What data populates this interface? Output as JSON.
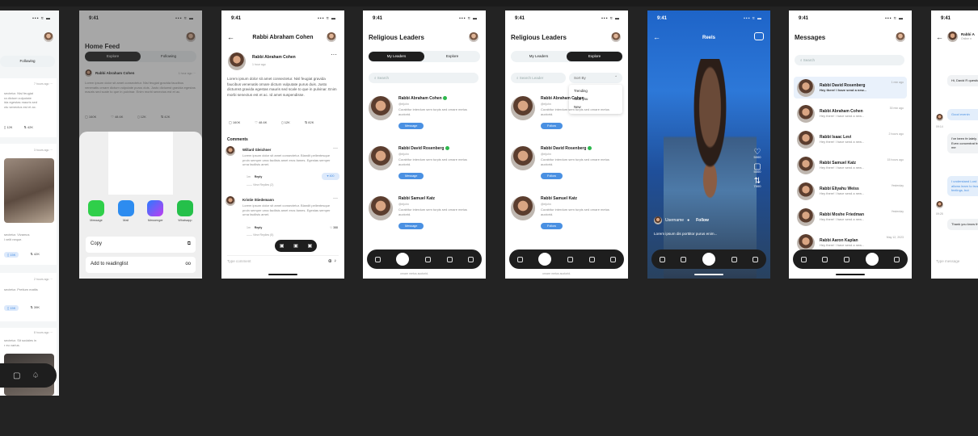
{
  "f1": {
    "status_right": "▪▪▪ ≈ ▬",
    "tab": "Following",
    "t1": "7 hours ago",
    "p1": [
      "sectetur. Nisl feugiat",
      "ra dictum vulputate",
      "ida egestas mauris sed",
      "ctu senectus est et ac."
    ],
    "s1": [
      "12K",
      "42K"
    ],
    "t2": "3 hours ago",
    "p2": [
      "sectetur. Vivamus",
      "l velit neque."
    ],
    "badge": "15K",
    "s2": "42K",
    "t3": "2 hours ago",
    "p3": "sectetur. Pretium mattis",
    "s3": "39K",
    "t4": "8 hours ago",
    "p4": [
      "sectetur. Sit sodales in",
      "r eu varius."
    ]
  },
  "f2": {
    "time": "9:41",
    "title": "Home Feed",
    "tabs": [
      "Explore",
      "Following"
    ],
    "author": "Rabbi Abraham Cohen",
    "ago": "1 hour ago",
    "post": "Lorem ipsum dolor sit amet consectetur. Nisl feugiat gravida faucibus venenatis ornare dictum vulputate purus duis. Justo dictumst gravida egestas mauris sed scale to que in pulvinar. Enim morbi senectus est et ac.",
    "stats": [
      "160K",
      "48.6K",
      "12K",
      "42K"
    ],
    "apps": [
      "Message",
      "Mail",
      "Messenger",
      "Whatsapp"
    ],
    "actions": [
      {
        "label": "Copy",
        "icon": "copy-icon"
      },
      {
        "label": "Add to readinglist",
        "icon": "glasses-icon"
      }
    ]
  },
  "f3": {
    "time": "9:41",
    "title": "Rabbi Abraham Cohen",
    "author": "Rabbi Abraham Cohen",
    "ago": "1 hour ago",
    "post": "Lorem ipsum dolor sit amet consectetur. Nisl feugiat gravida faucibus venenatis ornare dictum vulputate purus duis. Justo dictumst gravida egestas mauris sed scale to que in pulvinar. Enim morbi senectus est et ac. Id amet suspendisse.",
    "stats": [
      "160K",
      "48.6K",
      "12K",
      "82K"
    ],
    "comments_title": "Comments",
    "c1": {
      "name": "Willard Gleichner",
      "text": "Lorem ipsum dolor sit amet consectetur. Blandit pellentesque proin semper urna facilisis amet eros fames. Egestas semper urna facilisis amet.",
      "ago": "1m",
      "reply": "Reply",
      "likes": "400",
      "view": "View Replies (2)"
    },
    "c2": {
      "name": "Kristie Stiedemann",
      "text": "Lorem ipsum dolor sit amet consectetur. Blandit pellentesque proin semper urna facilisis amet eros fames. Egestas semper urna facilisis amet.",
      "ago": "1m",
      "reply": "Reply",
      "likes": "388",
      "view": "View Replies (5)"
    },
    "placeholder": "Type comment"
  },
  "f4": {
    "time": "9:41",
    "title": "Religious Leaders",
    "tabs": [
      "My Leaders",
      "Explore"
    ],
    "search": "Search",
    "handle": "@eljohn",
    "bio": "Curabitur interdum sem turpis sed ornare metus auctorid.",
    "button": "Message",
    "leaders": [
      "Rabbi Abraham Cohen",
      "Rabbi David Rosenberg",
      "Rabbi Samuel Katz"
    ],
    "footer": "ornare metus auctorid."
  },
  "f5": {
    "time": "9:41",
    "title": "Religious Leaders",
    "tabs": [
      "My Leaders",
      "Explore"
    ],
    "search": "Search Leader",
    "sort": "Sort By",
    "options": [
      "Trending",
      "Near you",
      "New"
    ],
    "handle": "@eljohn",
    "bio": "Curabitur interdum sem turpis sed ornare metus auctorid.",
    "button": "Follow",
    "leaders": [
      "Rabbi Abraham Cohen",
      "Rabbi David Rosenberg",
      "Rabbi Samuel Katz"
    ],
    "footer": "ornare metus auctorid."
  },
  "f6": {
    "time": "9:41",
    "title": "Reels",
    "counts": [
      "5000",
      "5000",
      "7000"
    ],
    "user": "Username",
    "follow": "Follow",
    "caption": "Lorem ipsum dis porttitor purus enim..."
  },
  "f7": {
    "time": "9:41",
    "title": "Messages",
    "search": "Search",
    "preview": "Hey there! I have send a new...",
    "rows": [
      {
        "name": "Rabbi David Rosenberg",
        "time": "1 min ago"
      },
      {
        "name": "Rabbi Abraham Cohen",
        "time": "30 min ago"
      },
      {
        "name": "Rabbi Isaac Levi",
        "time": "2 hours ago"
      },
      {
        "name": "Rabbi Samuel Katz",
        "time": "15 hours ago"
      },
      {
        "name": "Rabbi Eliyahu Weiss",
        "time": "Yesterday"
      },
      {
        "name": "Rabbi Moshe Friedman",
        "time": "Yesterday"
      },
      {
        "name": "Rabbi Aaron Kaplan",
        "time": "May 12, 2023"
      }
    ]
  },
  "f8": {
    "time": "9:41",
    "name": "Rabbi A",
    "status": "Online n",
    "b1": "Hi, David R question?",
    "b2": "Good evenin",
    "t1": "09:14",
    "b3": "I've been fe lately. Even concentrat from me",
    "b4": "I understand Lord allows learn to trust feelings, but",
    "t2": "09:25",
    "b5": "Thank you know that",
    "placeholder": "Type message"
  }
}
